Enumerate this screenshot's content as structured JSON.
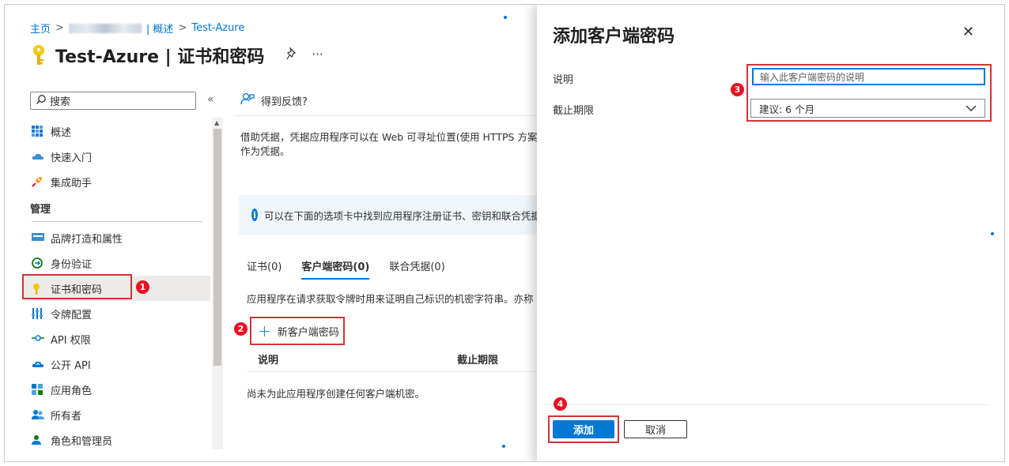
{
  "breadcrumb": {
    "home": "主页",
    "separator": ">",
    "overview": "| 概述",
    "separator2": ">",
    "app": "Test-Azure"
  },
  "page": {
    "title": "Test-Azure | 证书和密码",
    "pin_icon": "pin-icon",
    "more_icon": "···"
  },
  "search": {
    "placeholder": "搜索"
  },
  "collapse_label": "«",
  "nav": {
    "top_items": [
      {
        "label": "概述",
        "icon": "grid-icon"
      },
      {
        "label": "快速入门",
        "icon": "cloud-icon"
      },
      {
        "label": "集成助手",
        "icon": "rocket-icon"
      }
    ],
    "section": "管理",
    "manage_items": [
      {
        "label": "品牌打造和属性",
        "icon": "branding-icon"
      },
      {
        "label": "身份验证",
        "icon": "auth-icon"
      },
      {
        "label": "证书和密码",
        "icon": "key-icon",
        "active": true
      },
      {
        "label": "令牌配置",
        "icon": "token-icon"
      },
      {
        "label": "API 权限",
        "icon": "api-permission-icon"
      },
      {
        "label": "公开 API",
        "icon": "cloud-api-icon"
      },
      {
        "label": "应用角色",
        "icon": "app-roles-icon"
      },
      {
        "label": "所有者",
        "icon": "owners-icon"
      },
      {
        "label": "角色和管理员",
        "icon": "admin-icon"
      }
    ]
  },
  "main": {
    "feedback": "得到反馈?",
    "description_line1": "借助凭据，凭据应用程序可以在 Web 可寻址位置(使用 HTTPS 方案",
    "description_line2": "作为凭据。",
    "info_text": "可以在下面的选项卡中找到应用程序注册证书、密钥和联合凭据",
    "tabs": [
      {
        "label": "证书(0)"
      },
      {
        "label": "客户端密码(0)",
        "active": true
      },
      {
        "label": "联合凭据(0)"
      }
    ],
    "tab_description": "应用程序在请求获取令牌时用来证明自己标识的机密字符串。亦称",
    "new_secret_label": "新客户端密码",
    "table_headers": [
      "说明",
      "截止期限"
    ],
    "empty_text": "尚未为此应用程序创建任何客户端机密。"
  },
  "panel": {
    "title": "添加客户端密码",
    "close_icon": "✕",
    "description_label": "说明",
    "description_placeholder": "输入此客户端密码的说明",
    "expires_label": "截止期限",
    "expires_value": "建议: 6 个月",
    "add_button": "添加",
    "cancel_button": "取消"
  },
  "annotations": [
    "1",
    "2",
    "3",
    "4"
  ],
  "colors": {
    "accent": "#0078d4",
    "highlight": "#d13438",
    "badge": "#e81123"
  }
}
